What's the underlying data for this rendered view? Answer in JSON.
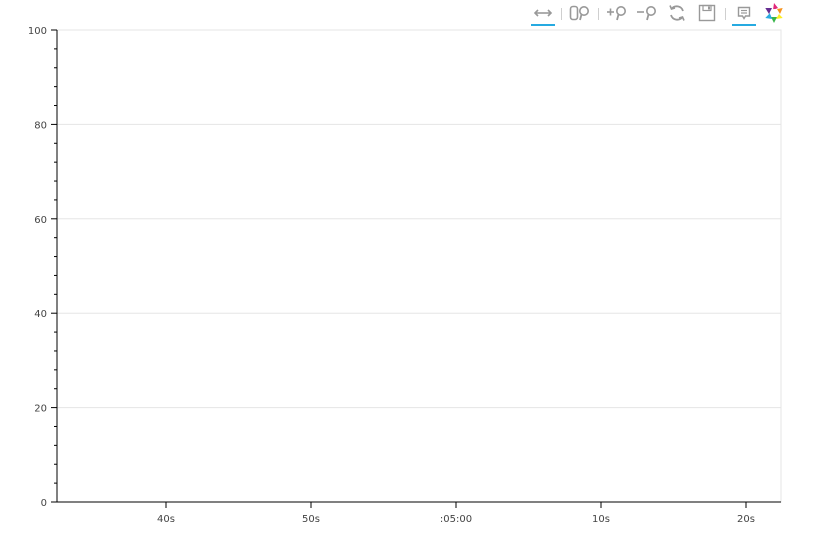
{
  "toolbar": {
    "tools": [
      {
        "name": "pan-tool",
        "icon": "x-pan-icon",
        "active": true
      },
      {
        "name": "box-zoom-tool",
        "icon": "box-zoom-icon",
        "active": false
      },
      {
        "name": "zoom-in-tool",
        "icon": "zoom-in-icon",
        "active": false
      },
      {
        "name": "zoom-out-tool",
        "icon": "zoom-out-icon",
        "active": false
      },
      {
        "name": "reset-tool",
        "icon": "reset-icon",
        "active": false
      },
      {
        "name": "save-tool",
        "icon": "save-icon",
        "active": false
      },
      {
        "name": "hover-tool",
        "icon": "hover-icon",
        "active": true
      }
    ],
    "logo": "bokeh-logo",
    "accent_color": "#26aae1"
  },
  "chart_data": {
    "type": "line",
    "title": "",
    "xlabel": "",
    "ylabel": "",
    "x_axis_type": "datetime",
    "x_ticks": [
      "40s",
      "50s",
      ":05:00",
      "10s",
      "20s"
    ],
    "y_ticks": [
      "0",
      "20",
      "40",
      "60",
      "80",
      "100"
    ],
    "ylim": [
      0,
      100
    ],
    "grid": true,
    "series": []
  }
}
